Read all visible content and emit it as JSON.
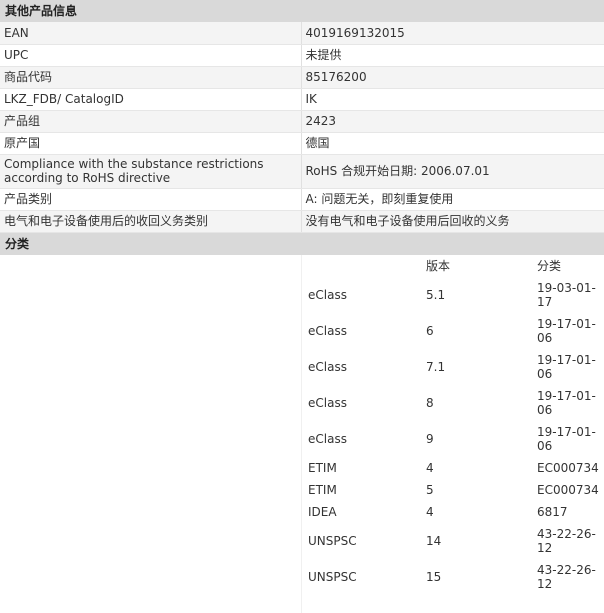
{
  "other_info": {
    "title": "其他产品信息",
    "rows": [
      {
        "label": "EAN",
        "value": "4019169132015"
      },
      {
        "label": "UPC",
        "value": "未提供"
      },
      {
        "label": "商品代码",
        "value": "85176200"
      },
      {
        "label": "LKZ_FDB/ CatalogID",
        "value": "IK"
      },
      {
        "label": "产品组",
        "value": "2423"
      },
      {
        "label": "原产国",
        "value": "德国"
      },
      {
        "label": "Compliance with the substance restrictions according to RoHS directive",
        "value": "RoHS 合规开始日期: 2006.07.01"
      },
      {
        "label": "产品类别",
        "value": "A: 问题无关，即刻重复使用"
      },
      {
        "label": "电气和电子设备使用后的收回义务类别",
        "value": "没有电气和电子设备使用后回收的义务"
      }
    ]
  },
  "classification": {
    "title": "分类",
    "headers": {
      "system": "",
      "version": "版本",
      "class": "分类"
    },
    "rows": [
      {
        "system": "eClass",
        "version": "5.1",
        "code": "19-03-01-17"
      },
      {
        "system": "eClass",
        "version": "6",
        "code": "19-17-01-06"
      },
      {
        "system": "eClass",
        "version": "7.1",
        "code": "19-17-01-06"
      },
      {
        "system": "eClass",
        "version": "8",
        "code": "19-17-01-06"
      },
      {
        "system": "eClass",
        "version": "9",
        "code": "19-17-01-06"
      },
      {
        "system": "ETIM",
        "version": "4",
        "code": "EC000734"
      },
      {
        "system": "ETIM",
        "version": "5",
        "code": "EC000734"
      },
      {
        "system": "IDEA",
        "version": "4",
        "code": "6817"
      },
      {
        "system": "UNSPSC",
        "version": "14",
        "code": "43-22-26-12"
      },
      {
        "system": "UNSPSC",
        "version": "15",
        "code": "43-22-26-12"
      }
    ]
  }
}
